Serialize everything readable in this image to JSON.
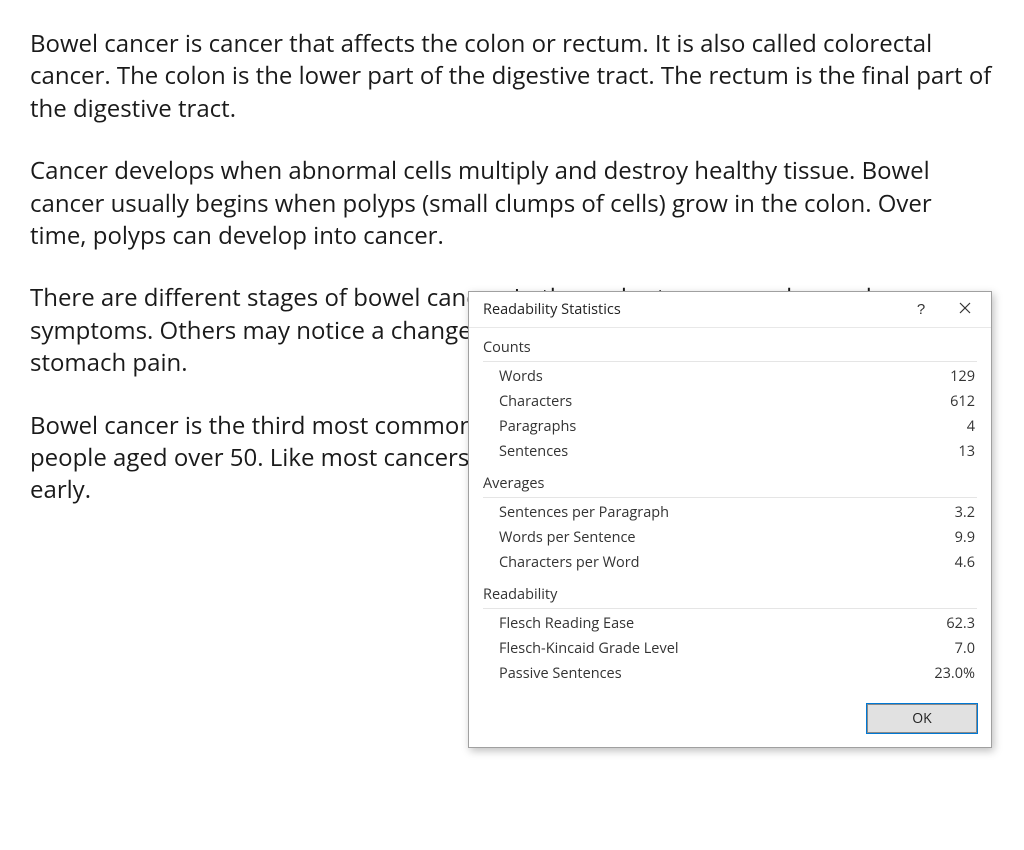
{
  "document": {
    "p1": "Bowel cancer is cancer that affects the colon or rectum. It is also called colorectal cancer. The colon is the lower part of the digestive tract. The rectum is the final part of the digestive tract.",
    "p2": "Cancer develops when abnormal cells multiply and destroy healthy tissue. Bowel cancer usually begins when polyps (small clumps of cells) grow in the colon. Over time, polyps can develop into cancer.",
    "p3": "There are different stages of bowel cancer. In the early stages, people may have no symptoms. Others may notice a change in their bowel habits, blood in their poo and stomach pain.",
    "p4": "Bowel cancer is the third most common type of cancer in the UK. It is usually found in people aged over 50. Like most cancers, bowel cancer can be treated if it is found early."
  },
  "dialog": {
    "title": "Readability Statistics",
    "sections": {
      "counts": {
        "header": "Counts",
        "rows": [
          {
            "label": "Words",
            "value": "129"
          },
          {
            "label": "Characters",
            "value": "612"
          },
          {
            "label": "Paragraphs",
            "value": "4"
          },
          {
            "label": "Sentences",
            "value": "13"
          }
        ]
      },
      "averages": {
        "header": "Averages",
        "rows": [
          {
            "label": "Sentences per Paragraph",
            "value": "3.2"
          },
          {
            "label": "Words per Sentence",
            "value": "9.9"
          },
          {
            "label": "Characters per Word",
            "value": "4.6"
          }
        ]
      },
      "readability": {
        "header": "Readability",
        "rows": [
          {
            "label": "Flesch Reading Ease",
            "value": "62.3"
          },
          {
            "label": "Flesch-Kincaid Grade Level",
            "value": "7.0"
          },
          {
            "label": "Passive Sentences",
            "value": "23.0%"
          }
        ]
      }
    },
    "help_label": "?",
    "ok_label": "OK"
  }
}
